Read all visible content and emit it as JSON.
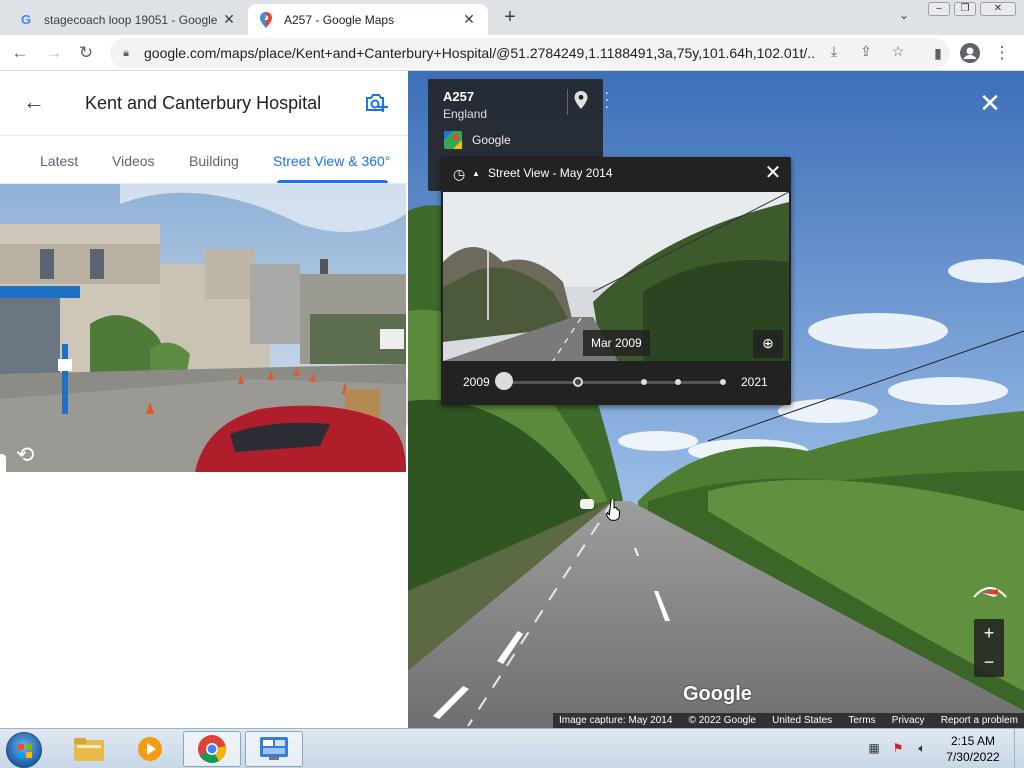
{
  "browser": {
    "tabs": [
      {
        "title": "stagecoach loop 19051 - Google",
        "icon": "google-icon",
        "active": false
      },
      {
        "title": "A257 - Google Maps",
        "icon": "maps-icon",
        "active": true
      }
    ],
    "new_tab_label": "+",
    "url": "google.com/maps/place/Kent+and+Canterbury+Hospital/@51.2784249,1.1188491,3a,75y,101.64h,102.01t/..."
  },
  "place": {
    "title": "Kent and Canterbury Hospital",
    "tabs": [
      {
        "label": "Latest",
        "active": false
      },
      {
        "label": "Videos",
        "active": false
      },
      {
        "label": "Building",
        "active": false
      },
      {
        "label": "Street View & 360°",
        "active": true
      }
    ]
  },
  "infocard": {
    "title": "A257",
    "subtitle": "England",
    "provider": "Google"
  },
  "timemachine": {
    "title": "Street View - May 2014",
    "preview_date": "Mar 2009",
    "year_start": "2009",
    "year_end": "2021",
    "selected_index": 1,
    "stops": 5
  },
  "map": {
    "watermark": "Google",
    "footer": [
      "Image capture: May 2014",
      "© 2022 Google",
      "United States",
      "Terms",
      "Privacy",
      "Report a problem"
    ],
    "zoom_in": "+",
    "zoom_out": "−"
  },
  "taskbar": {
    "time": "2:15 AM",
    "date": "7/30/2022"
  },
  "colors": {
    "accent": "#1a73e8",
    "tab_strip": "#dee1e6",
    "panel_dark": "#222222"
  }
}
